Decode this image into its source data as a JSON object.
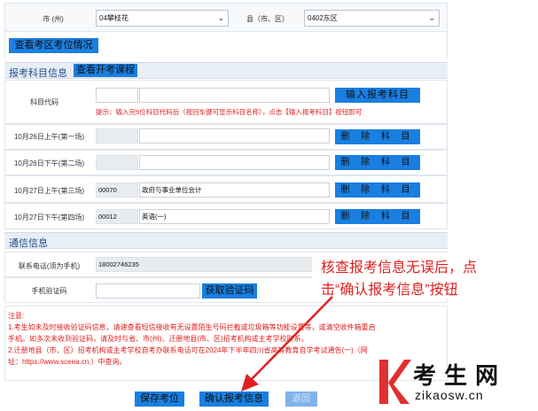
{
  "region": {
    "city_label": "市   (州)",
    "city_value": "04攀枝花",
    "district_label": "县（市、区）",
    "district_value": "0402东区",
    "view_seats_button": "查看考区考位情况"
  },
  "subject_info": {
    "heading": "报考科目信息",
    "view_courses_button": "查看开考课程",
    "code_label": "科目代码",
    "enter_button": "输入报考科目",
    "hint": "提示：输入完5位科目代码后（按回车键可显示科目名称），点击【输入报考科目】按钮即可",
    "delete_label": "删 除 科 目",
    "sessions": [
      {
        "label": "10月26日上午(第一场)",
        "code": "",
        "name": ""
      },
      {
        "label": "10月26日下午(第二场)",
        "code": "",
        "name": ""
      },
      {
        "label": "10月27日上午(第三场)",
        "code": "00070",
        "name": "政府与事业单位会计"
      },
      {
        "label": "10月27日下午(第四场)",
        "code": "00012",
        "name": "英语(一)"
      }
    ]
  },
  "contact": {
    "heading": "通信信息",
    "phone_label": "联系电话(须为手机)",
    "phone_value": "18002746235",
    "code_label": "手机验证码",
    "get_code_button": "获取验证码"
  },
  "notes": {
    "title": "注意:",
    "line1": "1.考生如未及时接收验证码信息，请速查看短信接收有无设置陌生号码拦截或垃圾箱等功能设置等，或清空收件箱重启",
    "line2": "手机。如多次未收到验证码，请及时与省、市(州)、迁册地县(市、区)招考机构或主考学校联系。",
    "line3": "2.迁册地县（市、区）招考机构或主考学校自考办联系电话可在2024年下半年四川省高等教育自学考试通告(一)（网",
    "line4": "址：https://www.sceea.cn.）中查询。"
  },
  "actions": {
    "save": "保存考位",
    "confirm": "确认报考信息",
    "return": "返回"
  },
  "annotation": {
    "line1": "核查报考信息无误后，点",
    "line2": "击“确认报考信息”按钮"
  },
  "watermark": {
    "text": "考 生 网",
    "url": "zikaosw.cn"
  },
  "colors": {
    "button_blue": "#1a7fe0",
    "section_bg": "#e8eef6",
    "heading_blue": "#1f4e8c",
    "hint_red": "#e02020",
    "watermark_red": "#e03030"
  }
}
